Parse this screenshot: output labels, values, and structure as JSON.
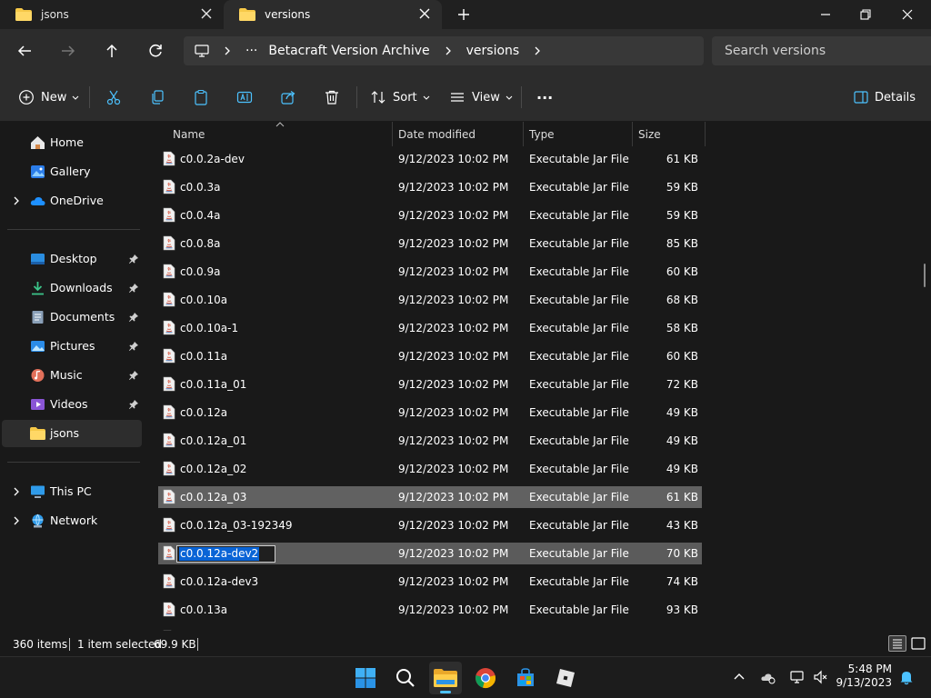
{
  "tabs": [
    {
      "label": "jsons",
      "active": false
    },
    {
      "label": "versions",
      "active": true
    }
  ],
  "address": {
    "ellipsis": "···",
    "crumbs": [
      "Betacraft Version Archive",
      "versions"
    ],
    "search_placeholder": "Search versions"
  },
  "toolbar": {
    "new_label": "New",
    "sort_label": "Sort",
    "view_label": "View",
    "more_label": "···",
    "details_label": "Details"
  },
  "nav": {
    "home": "Home",
    "gallery": "Gallery",
    "onedrive": "OneDrive",
    "desktop": "Desktop",
    "downloads": "Downloads",
    "documents": "Documents",
    "pictures": "Pictures",
    "music": "Music",
    "videos": "Videos",
    "jsons": "jsons",
    "thispc": "This PC",
    "network": "Network"
  },
  "columns": {
    "name": "Name",
    "date": "Date modified",
    "type": "Type",
    "size": "Size"
  },
  "files": [
    {
      "name": "c0.0.2a-dev",
      "date": "9/12/2023 10:02 PM",
      "type": "Executable Jar File",
      "size": "61 KB"
    },
    {
      "name": "c0.0.3a",
      "date": "9/12/2023 10:02 PM",
      "type": "Executable Jar File",
      "size": "59 KB"
    },
    {
      "name": "c0.0.4a",
      "date": "9/12/2023 10:02 PM",
      "type": "Executable Jar File",
      "size": "59 KB"
    },
    {
      "name": "c0.0.8a",
      "date": "9/12/2023 10:02 PM",
      "type": "Executable Jar File",
      "size": "85 KB"
    },
    {
      "name": "c0.0.9a",
      "date": "9/12/2023 10:02 PM",
      "type": "Executable Jar File",
      "size": "60 KB"
    },
    {
      "name": "c0.0.10a",
      "date": "9/12/2023 10:02 PM",
      "type": "Executable Jar File",
      "size": "68 KB"
    },
    {
      "name": "c0.0.10a-1",
      "date": "9/12/2023 10:02 PM",
      "type": "Executable Jar File",
      "size": "58 KB"
    },
    {
      "name": "c0.0.11a",
      "date": "9/12/2023 10:02 PM",
      "type": "Executable Jar File",
      "size": "60 KB"
    },
    {
      "name": "c0.0.11a_01",
      "date": "9/12/2023 10:02 PM",
      "type": "Executable Jar File",
      "size": "72 KB"
    },
    {
      "name": "c0.0.12a",
      "date": "9/12/2023 10:02 PM",
      "type": "Executable Jar File",
      "size": "49 KB"
    },
    {
      "name": "c0.0.12a_01",
      "date": "9/12/2023 10:02 PM",
      "type": "Executable Jar File",
      "size": "49 KB"
    },
    {
      "name": "c0.0.12a_02",
      "date": "9/12/2023 10:02 PM",
      "type": "Executable Jar File",
      "size": "49 KB"
    },
    {
      "name": "c0.0.12a_03",
      "date": "9/12/2023 10:02 PM",
      "type": "Executable Jar File",
      "size": "61 KB"
    },
    {
      "name": "c0.0.12a_03-192349",
      "date": "9/12/2023 10:02 PM",
      "type": "Executable Jar File",
      "size": "43 KB"
    },
    {
      "name": "c0.0.12a-dev2",
      "date": "9/12/2023 10:02 PM",
      "type": "Executable Jar File",
      "size": "70 KB"
    },
    {
      "name": "c0.0.12a-dev3",
      "date": "9/12/2023 10:02 PM",
      "type": "Executable Jar File",
      "size": "74 KB"
    },
    {
      "name": "c0.0.13a",
      "date": "9/12/2023 10:02 PM",
      "type": "Executable Jar File",
      "size": "93 KB"
    }
  ],
  "status": {
    "items": "360 items",
    "selected": "1 item selected",
    "selected_size": "69.9 KB"
  },
  "clock": {
    "time": "5:48 PM",
    "date": "9/13/2023"
  },
  "colors": {
    "accent": "#4cc2ff",
    "selection": "#0a64d6",
    "folder": "#f7c948"
  }
}
